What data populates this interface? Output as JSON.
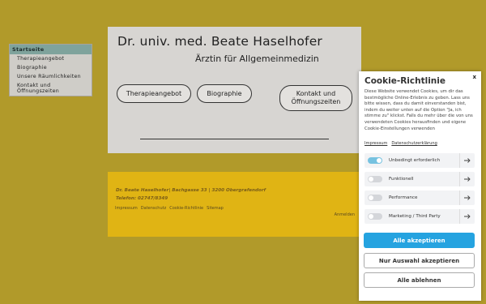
{
  "menu": {
    "header": "Startseite",
    "items": [
      "Therapieangebot",
      "Biographie",
      "Unsere Räumlichkeiten",
      "Kontakt und Öffnungszeiten"
    ]
  },
  "header": {
    "name": "Dr. univ. med. Beate Haselhofer",
    "subtitle": "Ärztin für Allgemeinmedizin",
    "buttons": {
      "therapy": "Therapieangebot",
      "bio": "Biographie",
      "contact": "Kontakt und Öffnungszeiten"
    }
  },
  "footer": {
    "address": "Dr. Beate Haselhofer| Bachgasse 33 | 3200 Obergrafendorf",
    "phone": "Telefon: 02747/8349",
    "links": [
      "Impressum",
      "Datenschutz",
      "Cookie-Richtlinie",
      "Sitemap"
    ],
    "login": "Anmelden"
  },
  "cookie": {
    "title": "Cookie-Richtlinie",
    "close": "x",
    "text": "Diese Website verwendet Cookies, um dir das bestmögliche Online-Erlebnis zu geben. Lass uns bitte wissen, dass du damit einverstanden bist, indem du weiter unten auf die Option \"Ja, ich stimme zu\" klickst. Falls du mehr über die von uns verwendeten Cookies herausfinden und eigene Cookie-Einstellungen verwenden",
    "links": [
      "Impressum",
      "Datenschutzerklärung"
    ],
    "rows": [
      {
        "label": "Unbedingt erforderlich",
        "on": true
      },
      {
        "label": "Funktionell",
        "on": false
      },
      {
        "label": "Performance",
        "on": false
      },
      {
        "label": "Marketing / Third Party",
        "on": false
      }
    ],
    "accept_all": "Alle akzeptieren",
    "accept_selection": "Nur Auswahl akzeptieren",
    "reject_all": "Alle ablehnen"
  },
  "colors": {
    "page_bg": "#b19a2a",
    "footer_bg": "#e0b414",
    "accent": "#25a3e0",
    "menu_header": "#7fa39c"
  }
}
